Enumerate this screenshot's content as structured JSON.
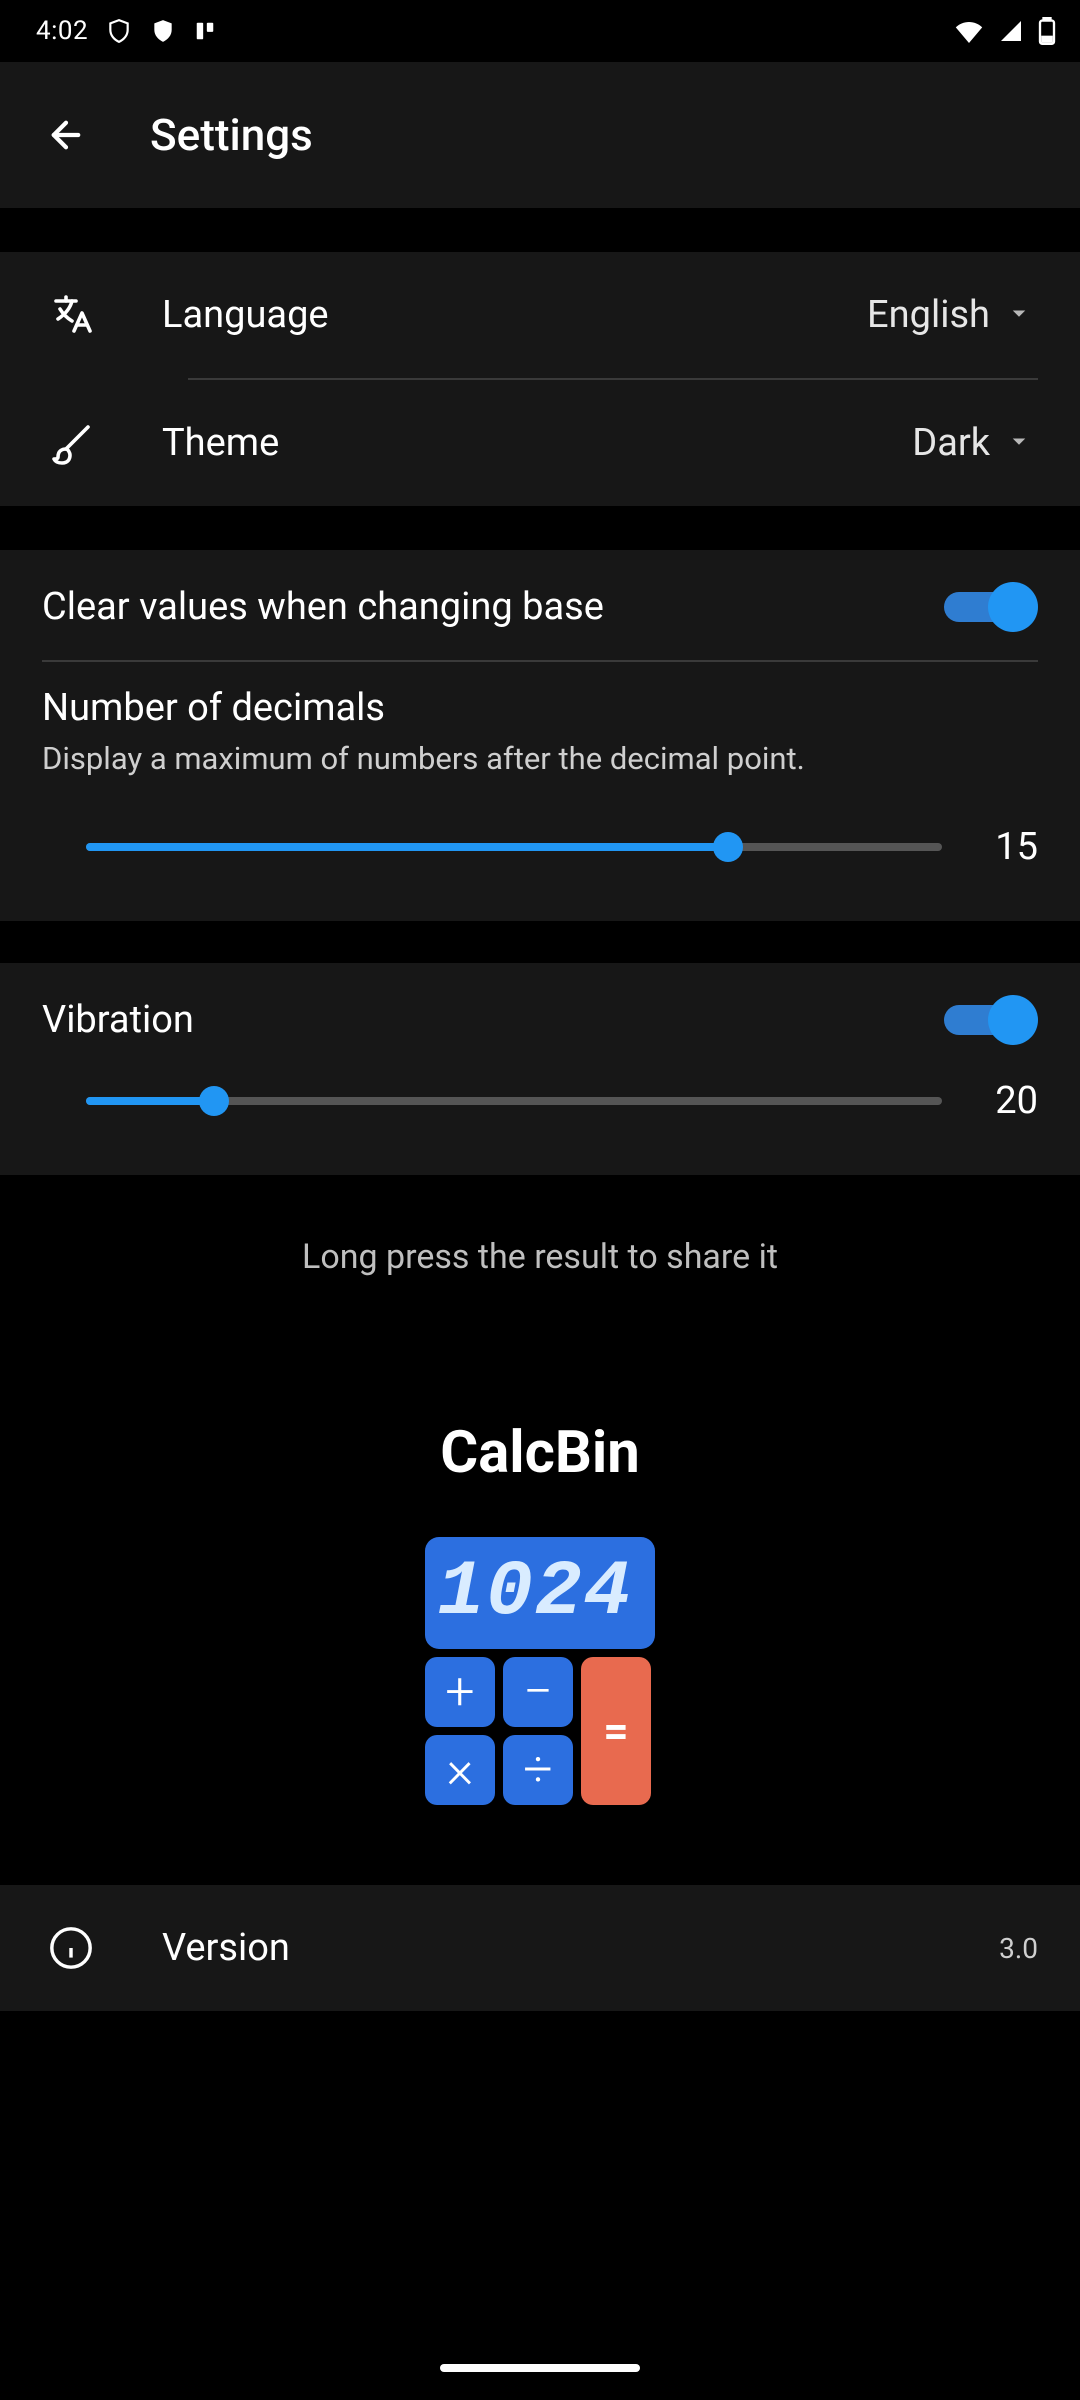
{
  "status": {
    "time": "4:02",
    "icons_left": [
      "privacy-shield-icon",
      "shield-check-icon",
      "more-apps-icon"
    ],
    "icons_right": [
      "wifi-icon",
      "signal-icon",
      "battery-icon"
    ]
  },
  "header": {
    "title": "Settings"
  },
  "settings": {
    "language": {
      "label": "Language",
      "value": "English"
    },
    "theme": {
      "label": "Theme",
      "value": "Dark"
    },
    "clear_values": {
      "label": "Clear values when changing base",
      "enabled": true
    },
    "decimals": {
      "title": "Number of decimals",
      "subtitle": "Display a maximum of numbers after the decimal point.",
      "value": 15,
      "min": 0,
      "max": 20,
      "percent": 75
    },
    "vibration": {
      "label": "Vibration",
      "enabled": true,
      "value": 20,
      "min": 0,
      "max": 100,
      "percent": 15
    }
  },
  "hint": "Long press the result to share it",
  "about": {
    "app_name": "CalcBin",
    "logo_display": "1024",
    "version_label": "Version",
    "version_value": "3.0"
  },
  "colors": {
    "accent": "#2196f3",
    "card": "#171717",
    "bg": "#000000"
  }
}
